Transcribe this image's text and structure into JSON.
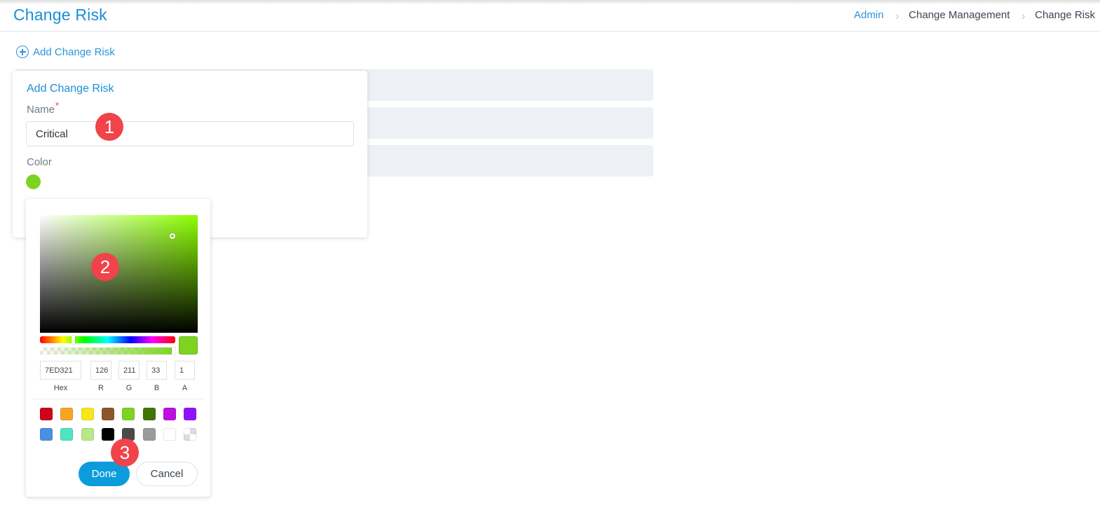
{
  "header": {
    "title": "Change Risk",
    "breadcrumb": [
      "Admin",
      "Change Management",
      "Change Risk"
    ],
    "separator": ">"
  },
  "toolbar": {
    "add_label": "Add Change Risk"
  },
  "form": {
    "title": "Add Change Risk",
    "name_label": "Name",
    "required_mark": "*",
    "name_value": "Critical",
    "color_label": "Color",
    "color_value": "#7ED321"
  },
  "color_picker": {
    "hue_color": "#8CFF00",
    "hex": "7ED321",
    "r": "126",
    "g": "211",
    "b": "33",
    "a": "1",
    "labels": {
      "hex": "Hex",
      "r": "R",
      "g": "G",
      "b": "B",
      "a": "A"
    },
    "presets": [
      "#D0021B",
      "#F5A623",
      "#F8E71C",
      "#8B572A",
      "#7ED321",
      "#417505",
      "#BD10E0",
      "#9013FE",
      "#4A90E2",
      "#50E3C2",
      "#B8E986",
      "#000000",
      "#4A4A4A",
      "#9B9B9B",
      "#FFFFFF",
      "transparent"
    ],
    "done_label": "Done",
    "cancel_label": "Cancel"
  },
  "annotations": [
    "1",
    "2",
    "3"
  ]
}
